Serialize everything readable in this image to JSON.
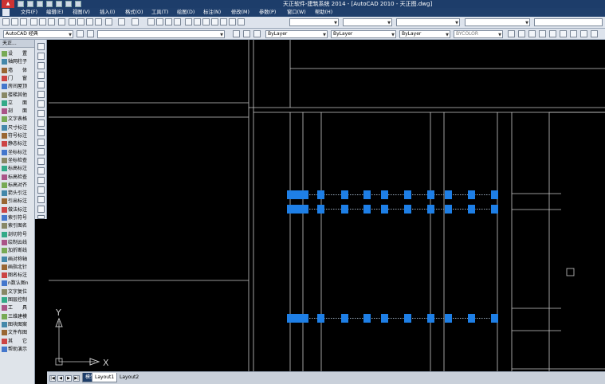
{
  "window": {
    "title": "天正软件-建筑系统 2014 - [AutoCAD 2010 - 天正图.dwg]"
  },
  "menu": {
    "items": [
      "文件(F)",
      "编辑(E)",
      "视图(V)",
      "插入(I)",
      "格式(O)",
      "工具(T)",
      "绘图(D)",
      "标注(N)",
      "修改(M)",
      "参数(P)",
      "窗口(W)",
      "帮助(H)"
    ]
  },
  "toolbar2": {
    "workspace": "AutoCAD 经典",
    "layer_color": "ByLayer",
    "linetype": "ByLayer",
    "lineweight": "ByLayer",
    "plot_style": "BYCOLOR"
  },
  "palette": {
    "title": "天正...",
    "items": [
      "设　　置",
      "轴网柱子",
      "墙　　体",
      "门　　窗",
      "房间屋顶",
      "楼梯其他",
      "立　　面",
      "剖　　面",
      "文字表格",
      "尺寸标注",
      "符号标注",
      "静态标注",
      "坐标标注",
      "坐标检查",
      "标高标注",
      "标高检查",
      "标高对齐",
      "箭头引注",
      "引出标注",
      "做法标注",
      "索引符号",
      "索引图名",
      "剖切符号",
      "绘制云线",
      "加折断线",
      "画对称轴",
      "画指北针",
      "图名标注",
      "n数认图n",
      "文字复位",
      "图层控制",
      "工　　具",
      "三维建模",
      "图块图案",
      "文件布图",
      "其　　它",
      "帮助演示"
    ]
  },
  "ucs": {
    "x_label": "X",
    "y_label": "Y"
  },
  "colors": {
    "selection_blue": "#1e7fe6",
    "linework": "#c8c8c8",
    "background": "#000000"
  },
  "layout_tabs": {
    "model": "模型",
    "tabs": [
      "Layout1",
      "Layout2"
    ]
  }
}
